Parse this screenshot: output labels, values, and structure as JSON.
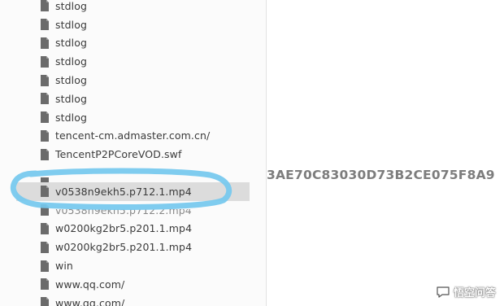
{
  "file_list": {
    "items": [
      {
        "name": "stdlog",
        "state": "normal"
      },
      {
        "name": "stdlog",
        "state": "normal"
      },
      {
        "name": "stdlog",
        "state": "normal"
      },
      {
        "name": "stdlog",
        "state": "normal"
      },
      {
        "name": "stdlog",
        "state": "normal"
      },
      {
        "name": "stdlog",
        "state": "normal"
      },
      {
        "name": "stdlog",
        "state": "normal"
      },
      {
        "name": "tencent-cm.admaster.com.cn/",
        "state": "normal"
      },
      {
        "name": "TencentP2PCoreVOD.swf",
        "state": "normal"
      },
      {
        "name": "",
        "state": "hidden"
      },
      {
        "name": "v0538n9ekh5.p712.1.mp4",
        "state": "selected"
      },
      {
        "name": "v0538n9ekh5.p712.2.mp4",
        "state": "partial"
      },
      {
        "name": "w0200kg2br5.p201.1.mp4",
        "state": "normal"
      },
      {
        "name": "w0200kg2br5.p201.1.mp4",
        "state": "normal"
      },
      {
        "name": "win",
        "state": "normal"
      },
      {
        "name": "www.qq.com/",
        "state": "normal"
      },
      {
        "name": "www.qq.com/",
        "state": "normal"
      }
    ]
  },
  "detail_panel": {
    "hash_text": "3AE70C83030D73B2CE075F8A9"
  },
  "watermark": {
    "text": "悟空问答"
  },
  "colors": {
    "annotation_circle": "#74c8ee",
    "selected_row": "#dcdcdc",
    "file_icon": "#6b6b6b"
  }
}
